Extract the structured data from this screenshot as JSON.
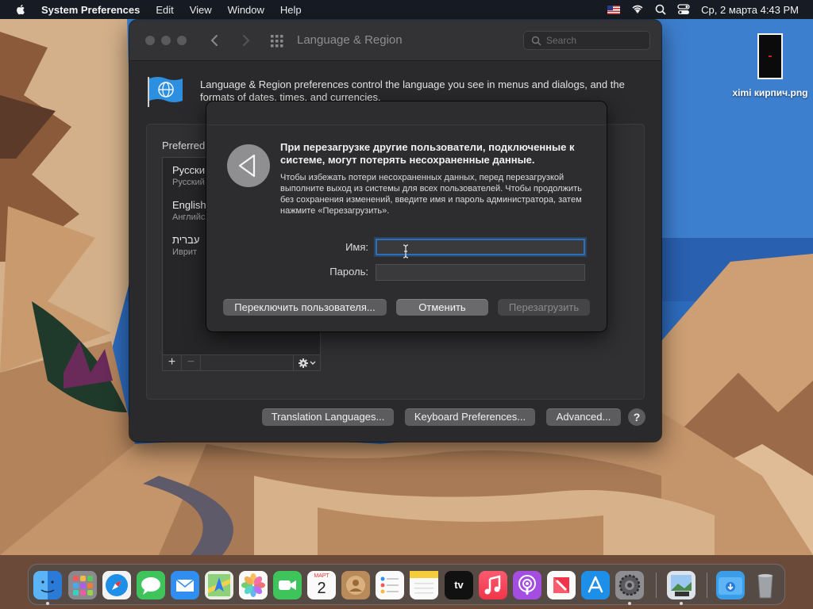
{
  "menubar": {
    "app_name": "System Preferences",
    "items": [
      "Edit",
      "View",
      "Window",
      "Help"
    ],
    "clock": "Ср, 2 марта  4:43 PM"
  },
  "desktop": {
    "file_label": "ximi кирпич.png"
  },
  "window": {
    "title": "Language & Region",
    "search_placeholder": "Search",
    "description": "Language & Region preferences control the language you see in menus and dialogs, and the formats of dates, times, and currencies.",
    "preferred_label": "Preferred",
    "languages": [
      {
        "name": "Русски",
        "sub": "Русский"
      },
      {
        "name": "English",
        "sub": "Английс"
      },
      {
        "name": "עברית",
        "sub": "Иврит"
      }
    ],
    "add_label": "+",
    "remove_label": "−",
    "buttons": {
      "translation": "Translation Languages...",
      "keyboard": "Keyboard Preferences...",
      "advanced": "Advanced...",
      "help": "?"
    }
  },
  "dialog": {
    "title": "При перезагрузке другие пользователи, подключенные к системе, могут потерять несохраненные данные.",
    "body": "Чтобы избежать потери несохраненных данных, перед перезагрузкой выполните выход из системы для всех пользователей. Чтобы продолжить без сохранения изменений, введите имя и пароль администратора, затем нажмите «Перезагрузить».",
    "name_label": "Имя:",
    "name_value": "",
    "password_label": "Пароль:",
    "password_value": "",
    "buttons": {
      "switch_user": "Переключить пользователя...",
      "cancel": "Отменить",
      "restart": "Перезагрузить"
    }
  },
  "dock": {
    "calendar_month": "МАРТ",
    "calendar_day": "2",
    "tv_label": "tv"
  },
  "colors": {
    "accent": "#2f6fba",
    "window_bg": "#2a2a2c",
    "dialog_bg": "#2d2d2f"
  }
}
